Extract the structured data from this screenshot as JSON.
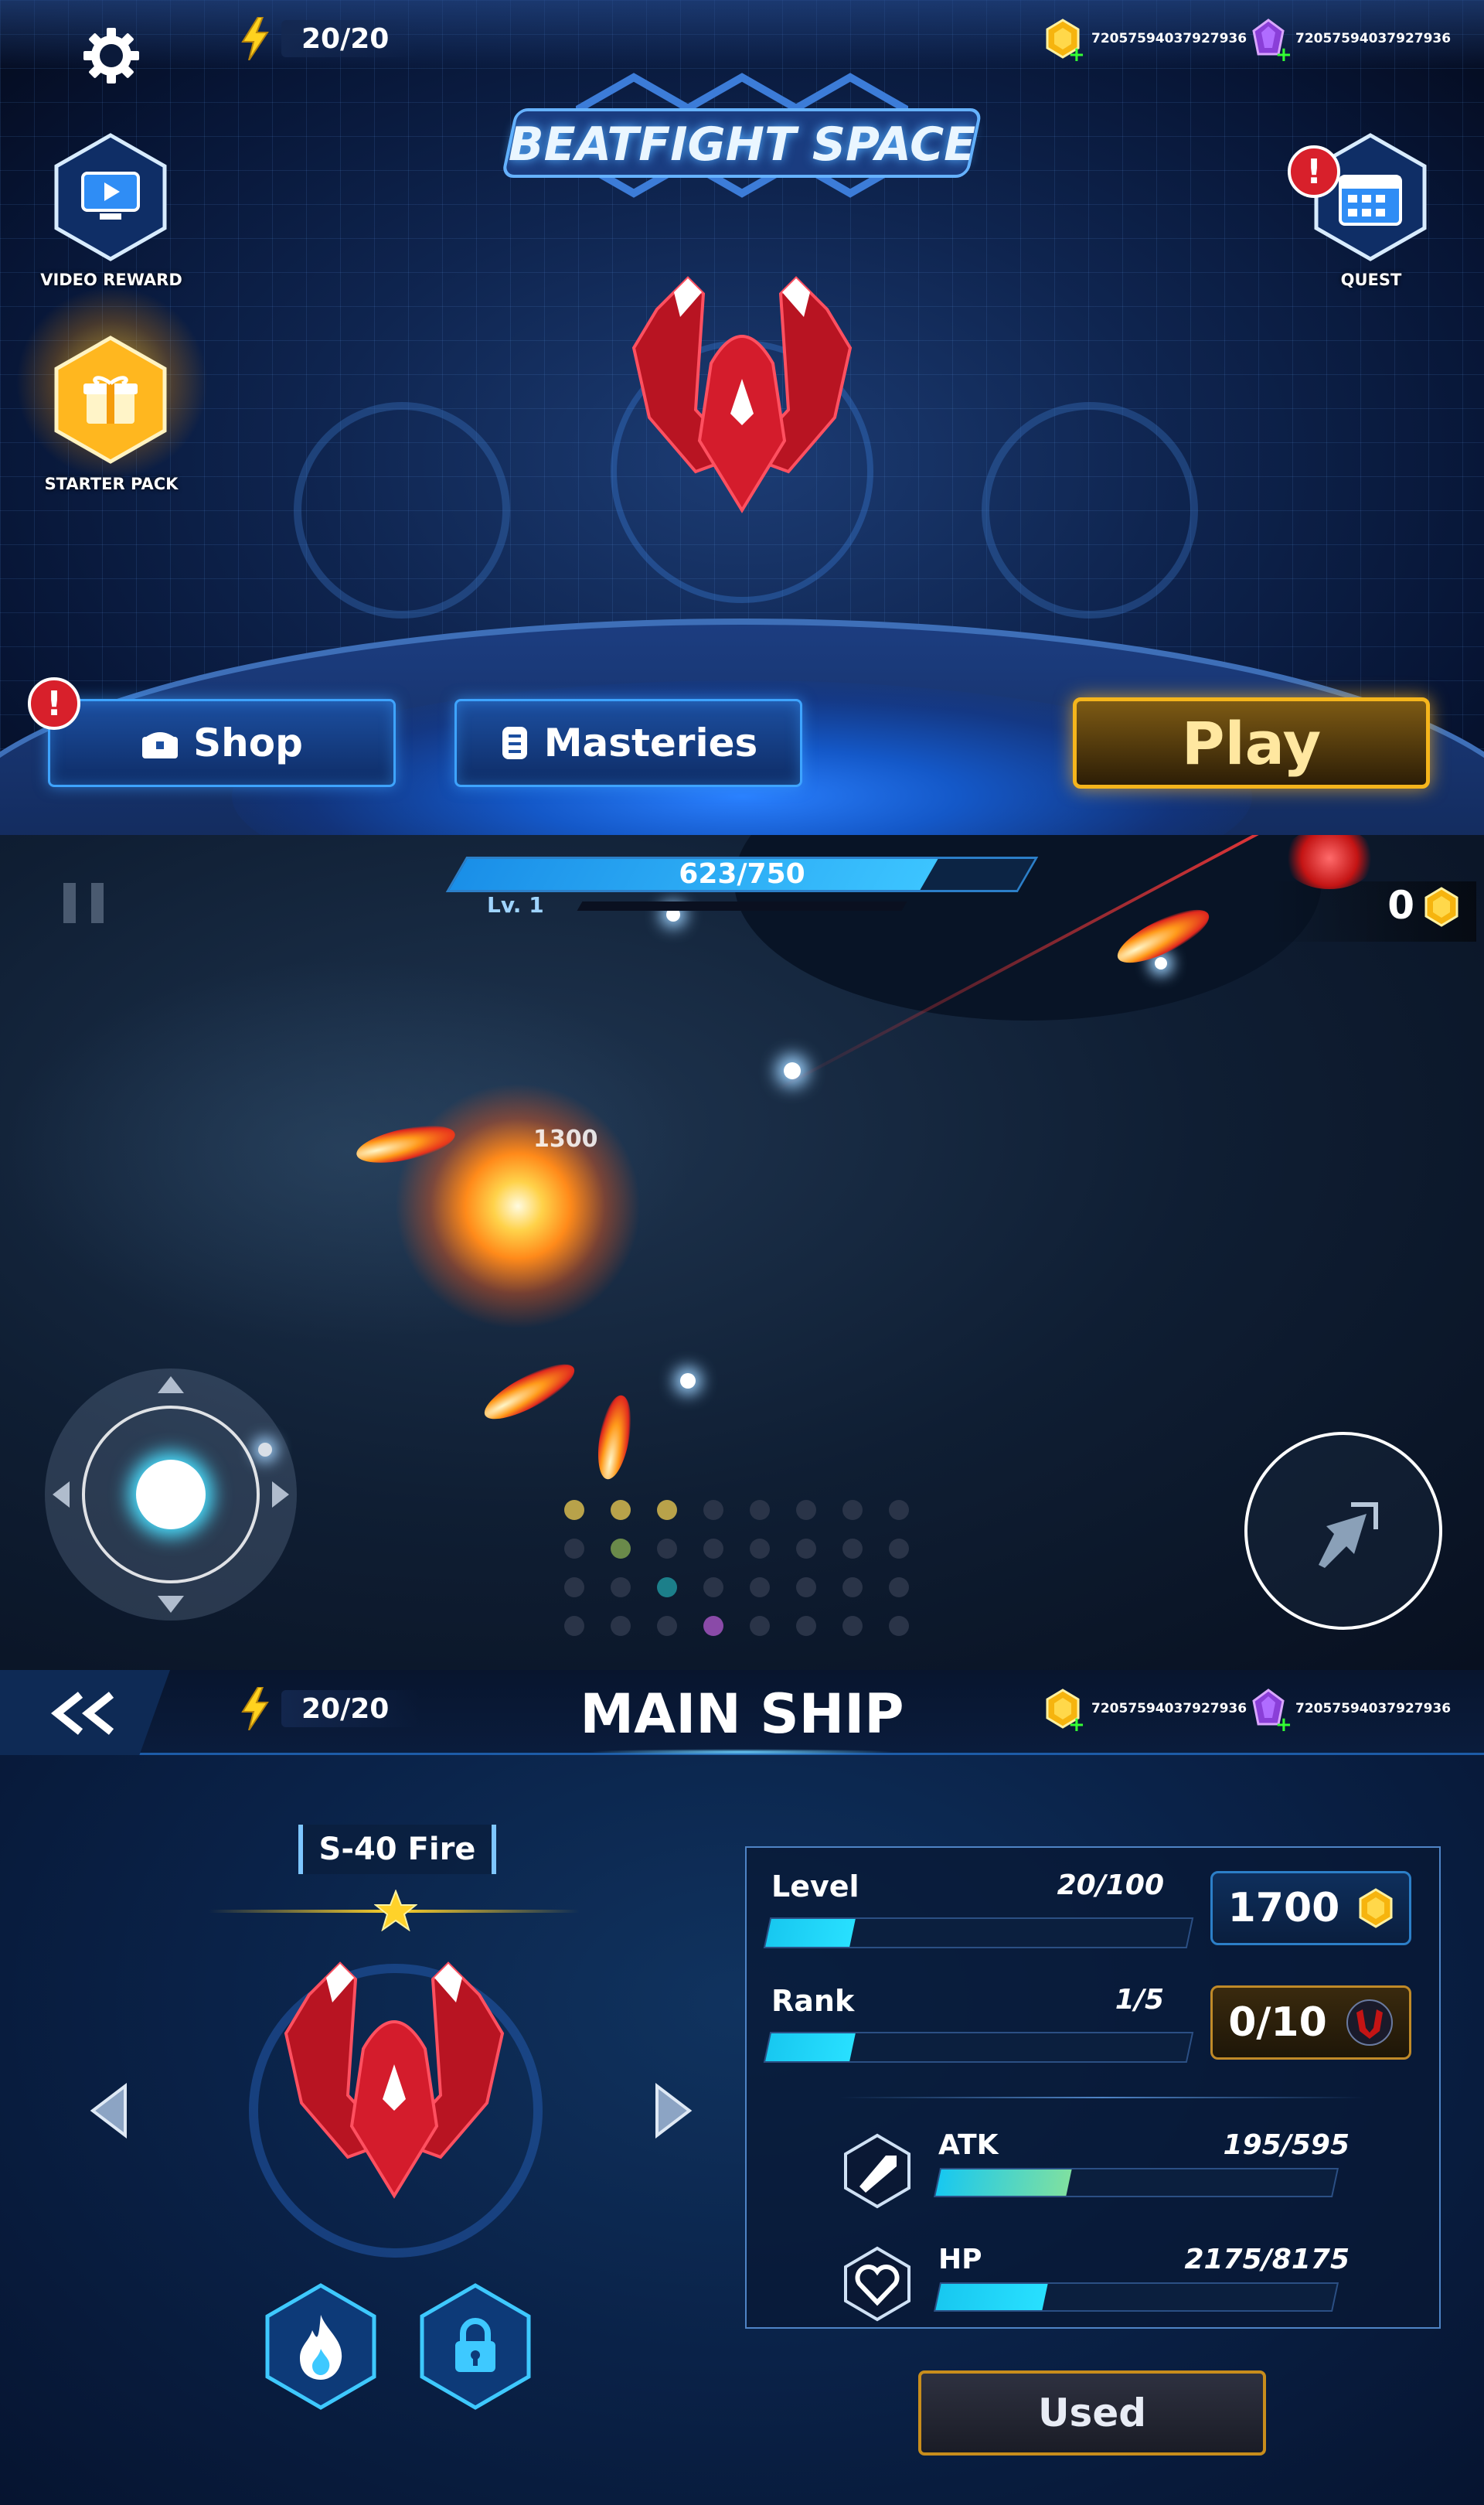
{
  "lobby": {
    "energy": "20/20",
    "coins": "72057594037927936",
    "gems": "72057594037927936",
    "logo_text": "BEATFIGHT SPACE",
    "video_reward_label": "VIDEO REWARD",
    "starter_pack_label": "STARTER PACK",
    "quest_label": "QUEST",
    "shop_label": "Shop",
    "masteries_label": "Masteries",
    "play_label": "Play",
    "alert_mark": "!",
    "icons": [
      "gear-icon",
      "lightning-icon",
      "coin-icon",
      "gem-icon",
      "tv-icon",
      "gift-icon",
      "calendar-icon",
      "treasure-icon",
      "scroll-icon"
    ],
    "colors": {
      "play_border": "#f5b51c",
      "button_border": "#3ea4ff",
      "ship": "#d41c2c"
    }
  },
  "battle": {
    "pause_icon": "pause-icon",
    "xp_text": "623/750",
    "xp_progress": 0.83,
    "level": "Lv. 1",
    "coins": "0",
    "damage_text": "1300",
    "joystick_icon": "joystick-icon",
    "dash_icon": "dash-icon"
  },
  "ship_menu": {
    "back_icon": "double-chevron-left-icon",
    "energy": "20/20",
    "title": "MAIN SHIP",
    "coins": "72057594037927936",
    "gems": "72057594037927936",
    "ship_name": "S-40 Fire",
    "stars": 1,
    "level_label": "Level",
    "level_value": "20/100",
    "level_progress": 0.2,
    "upgrade_cost": "1700",
    "rank_label": "Rank",
    "rank_value": "1/5",
    "rank_progress": 0.2,
    "rank_cost": "0/10",
    "atk_label": "ATK",
    "atk_value": "195/595",
    "atk_progress": 0.33,
    "hp_label": "HP",
    "hp_value": "2175/8175",
    "hp_progress": 0.27,
    "used_label": "Used",
    "skill_icons": [
      "flame-icon",
      "lock-icon"
    ]
  }
}
